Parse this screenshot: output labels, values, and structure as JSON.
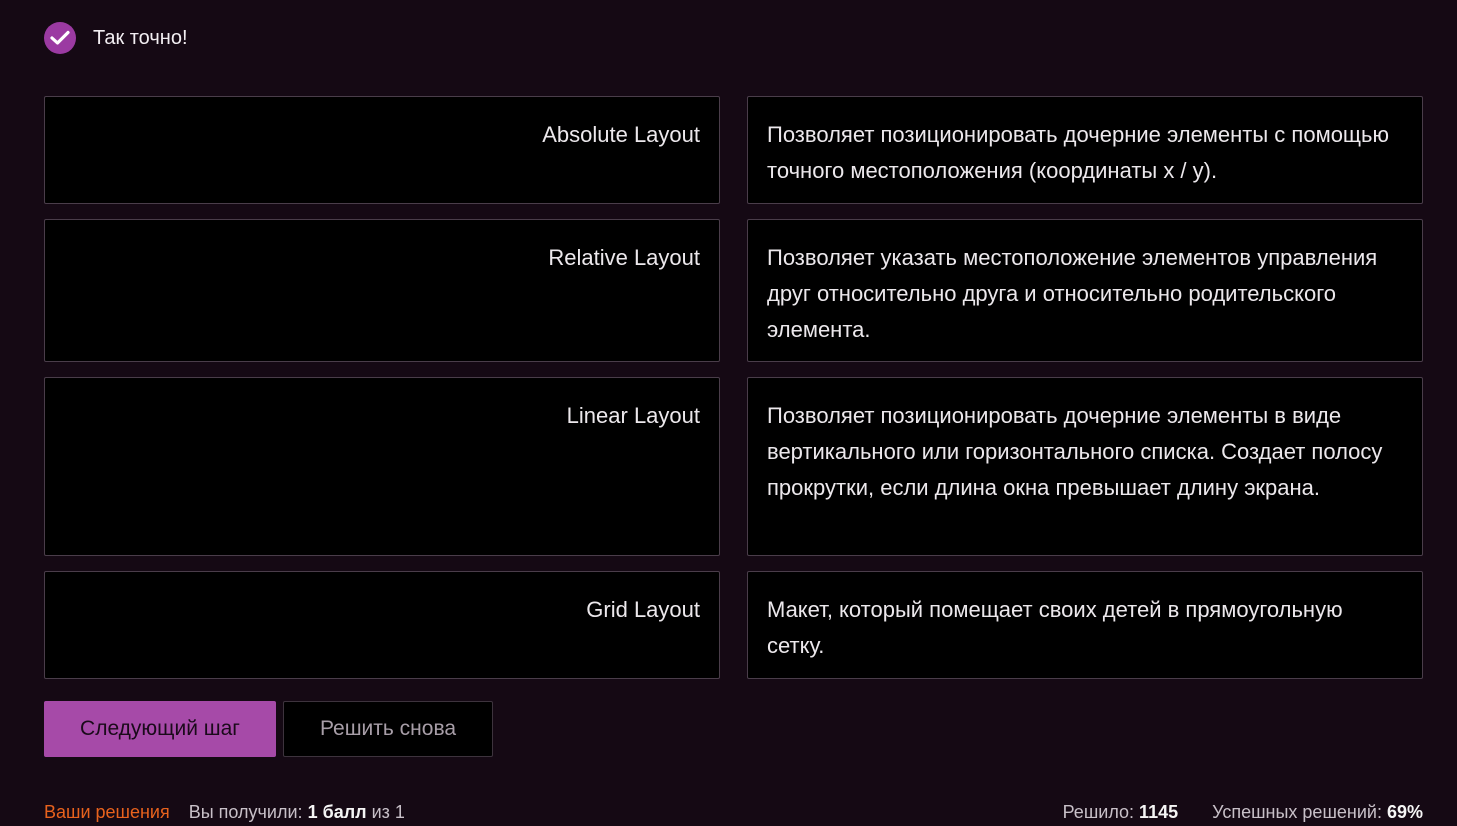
{
  "status": {
    "icon": "check-circle-icon",
    "text": "Так точно!"
  },
  "pairs": [
    {
      "term": "Absolute Layout",
      "description": "Позволяет позиционировать дочерние элементы с помощью точного местоположения (координаты x / y)."
    },
    {
      "term": "Relative Layout",
      "description": "Позволяет указать местоположение элементов управления друг относительно друга и относительно родительского элемента."
    },
    {
      "term": "Linear Layout",
      "description": "Позволяет позиционировать дочерние элементы в виде вертикального или горизонтального списка. Создает полосу прокрутки, если длина окна превышает длину экрана."
    },
    {
      "term": "Grid Layout",
      "description": "Макет, который помещает своих детей в прямоугольную сетку."
    }
  ],
  "buttons": {
    "next": "Следующий шаг",
    "retry": "Решить снова"
  },
  "footer": {
    "solutions_link": "Ваши решения",
    "score_prefix": "Вы получили:",
    "score_value": "1 балл",
    "score_suffix": "из 1",
    "solved_label": "Решило:",
    "solved_value": "1145",
    "success_label": "Успешных решений:",
    "success_value": "69%"
  },
  "colors": {
    "background": "#150914",
    "accent": "#a64aa8",
    "link": "#e8621d"
  }
}
